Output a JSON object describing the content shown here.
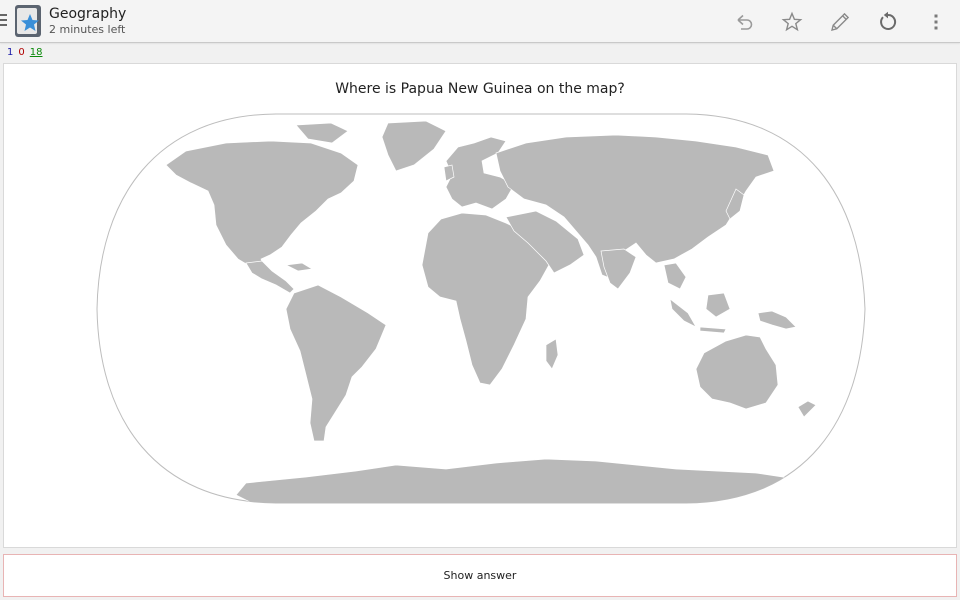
{
  "actionbar": {
    "title": "Geography",
    "subtitle": "2 minutes left",
    "actions": [
      "undo-icon",
      "star-icon",
      "pencil-icon",
      "replay-icon",
      "overflow-menu-icon"
    ]
  },
  "counts": {
    "new": "1",
    "learning": "0",
    "review": "18"
  },
  "card": {
    "question": "Where is Papua New Guinea on the map?"
  },
  "answer": {
    "label": "Show answer"
  },
  "colors": {
    "land": "#b9b9b9",
    "border": "#ffffff",
    "new": "#1a1aa8",
    "learning": "#b00000",
    "review": "#0a8a0a",
    "answer_border": "#e8b4b4"
  }
}
